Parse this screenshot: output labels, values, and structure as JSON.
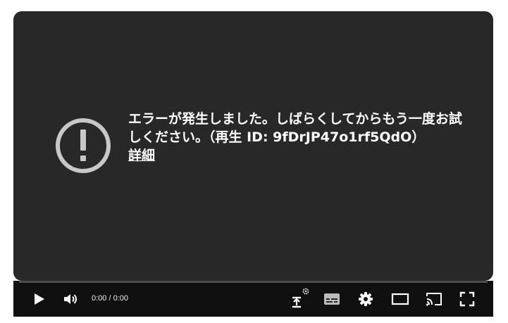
{
  "error": {
    "message": "エラーが発生しました。しばらくしてからもう一度お試しください。（再生 ID: 9fDrJP47o1rf5QdO）",
    "details_link": "詳細"
  },
  "controls": {
    "time_display": "0:00 / 0:00"
  },
  "colors": {
    "screen": "#282828",
    "controls_bar": "#0f0f0f",
    "icon": "#ffffff",
    "error_icon": "#c8c8c8"
  }
}
